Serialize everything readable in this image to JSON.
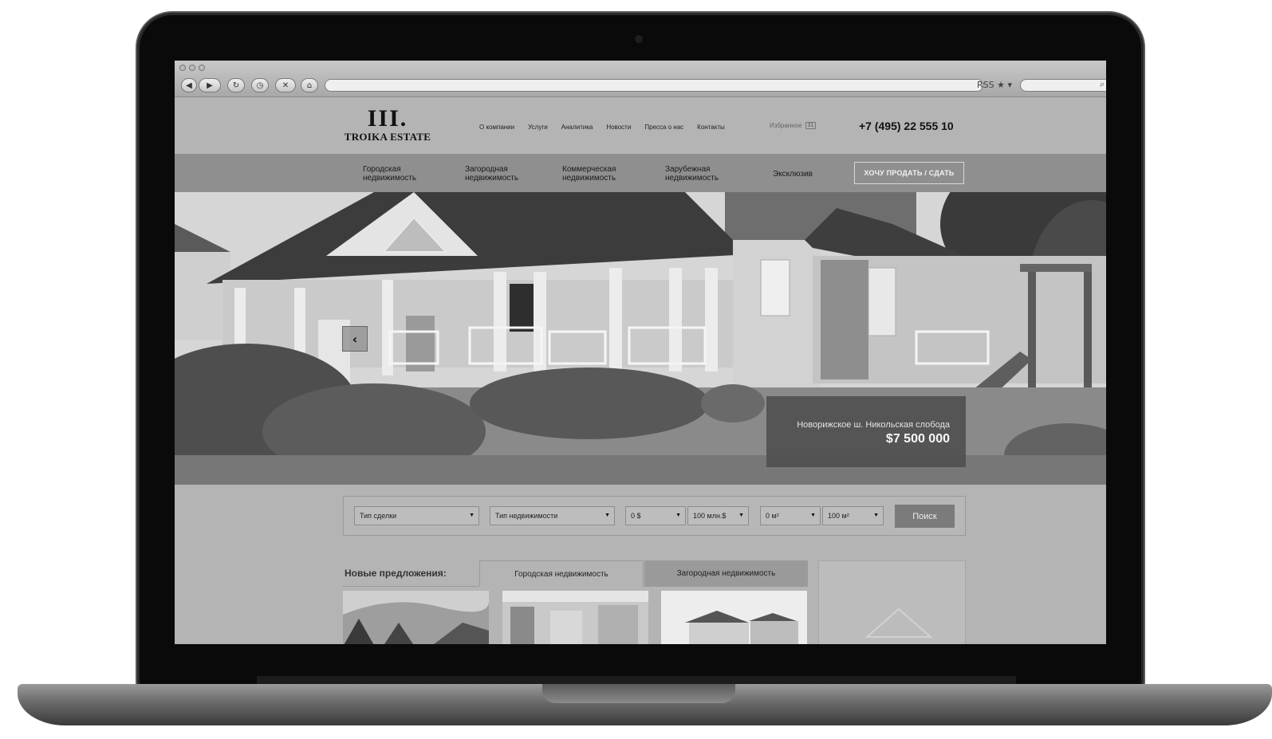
{
  "browser": {
    "nav_buttons": [
      "◀",
      "▶",
      "↻",
      "◷",
      "✕",
      "⌂"
    ],
    "url_icons": "RSS ★ ▾",
    "search_icon": "⌕"
  },
  "header": {
    "logo_mark": "III.",
    "logo_text": "TROIKA ESTATE",
    "nav": [
      "О компании",
      "Услуги",
      "Аналитика",
      "Новости",
      "Пресса о нас",
      "Контакты"
    ],
    "favorites_label": "Избранное",
    "favorites_count": "31",
    "phone": "+7 (495) 22 555 10"
  },
  "categories": {
    "items": [
      {
        "line1": "Городская",
        "line2": "недвижимость"
      },
      {
        "line1": "Загородная",
        "line2": "недвижимость"
      },
      {
        "line1": "Коммерческая",
        "line2": "недвижимость"
      },
      {
        "line1": "Зарубежная",
        "line2": "недвижимость"
      },
      {
        "line1": "Эксклюзив",
        "line2": ""
      }
    ],
    "sell_button": "ХОЧУ ПРОДАТЬ / СДАТЬ"
  },
  "hero": {
    "prev_arrow": "‹",
    "address": "Новорижское ш. Никольская слобода",
    "price": "$7 500 000"
  },
  "search": {
    "deal_type": "Тип сделки",
    "property_type": "Тип недвижимости",
    "price_from": "0 $",
    "price_to": "100 млн.$",
    "area_from": "0 м²",
    "area_to": "100 м²",
    "dropdown_arrow": "▼",
    "button": "Поиск"
  },
  "listings": {
    "title": "Новые предложения:",
    "tabs": [
      "Городская недвижимость",
      "Загородная недвижимость"
    ]
  },
  "colors": {
    "site_bg": "#b4b4b4",
    "category_bar": "#8f8f8f",
    "caption_bg": "#505050",
    "search_button": "#7b7b7b"
  }
}
